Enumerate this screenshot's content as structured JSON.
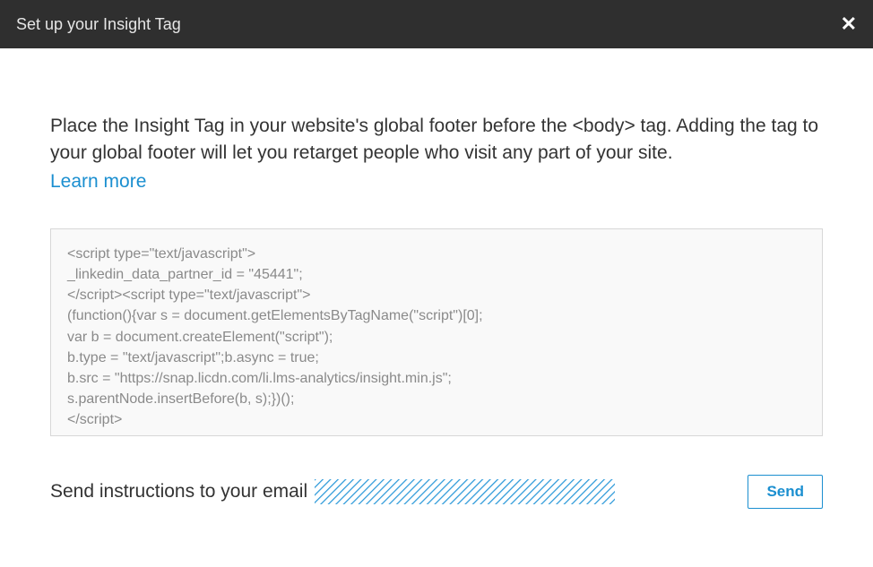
{
  "header": {
    "title": "Set up your Insight Tag"
  },
  "main": {
    "instruction": "Place the Insight Tag in your website's global footer before the <body> tag. Adding the tag to your global footer will let you retarget people who visit any part of your site.",
    "learn_more": "Learn more",
    "code": "<script type=\"text/javascript\">\n_linkedin_data_partner_id = \"45441\";\n</script><script type=\"text/javascript\">\n(function(){var s = document.getElementsByTagName(\"script\")[0];\nvar b = document.createElement(\"script\");\nb.type = \"text/javascript\";b.async = true;\nb.src = \"https://snap.licdn.com/li.lms-analytics/insight.min.js\";\ns.parentNode.insertBefore(b, s);})();\n</script>"
  },
  "footer": {
    "email_label": "Send instructions to your email",
    "send_label": "Send"
  }
}
